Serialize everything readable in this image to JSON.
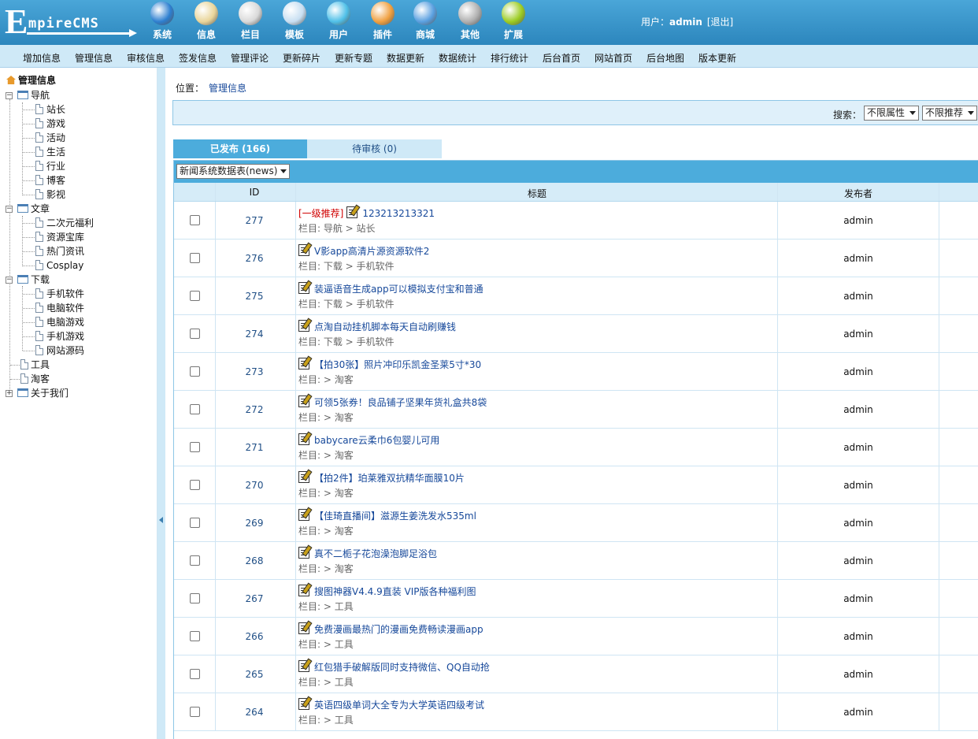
{
  "header": {
    "logo_first": "E",
    "logo_rest": "mpireCMS",
    "nav": [
      {
        "label": "系统",
        "icon": "globe-icon",
        "color": "#2d7fd0"
      },
      {
        "label": "信息",
        "icon": "notepad-icon",
        "color": "#e9d59a"
      },
      {
        "label": "栏目",
        "icon": "folder-icon",
        "color": "#d9d9d9"
      },
      {
        "label": "模板",
        "icon": "window-icon",
        "color": "#c8dff2"
      },
      {
        "label": "用户",
        "icon": "user-icon",
        "color": "#4fc0e8"
      },
      {
        "label": "插件",
        "icon": "tools-icon",
        "color": "#f0a040"
      },
      {
        "label": "商城",
        "icon": "card-icon",
        "color": "#5aa0e0"
      },
      {
        "label": "其他",
        "icon": "gear-icon",
        "color": "#b0b0b0"
      },
      {
        "label": "扩展",
        "icon": "plus-circle-icon",
        "color": "#9ccc22"
      }
    ],
    "user_label": "用户：",
    "username": "admin",
    "logout": "[退出]"
  },
  "subnav": [
    "增加信息",
    "管理信息",
    "审核信息",
    "签发信息",
    "管理评论",
    "更新碎片",
    "更新专题",
    "数据更新",
    "数据统计",
    "排行统计",
    "后台首页",
    "网站首页",
    "后台地图",
    "版本更新"
  ],
  "sidebar": {
    "root": "管理信息",
    "nodes": [
      {
        "label": "导航",
        "type": "folder",
        "expanded": true
      },
      {
        "label": "站长",
        "type": "page"
      },
      {
        "label": "游戏",
        "type": "page"
      },
      {
        "label": "活动",
        "type": "page"
      },
      {
        "label": "生活",
        "type": "page"
      },
      {
        "label": "行业",
        "type": "page"
      },
      {
        "label": "博客",
        "type": "page"
      },
      {
        "label": "影视",
        "type": "page"
      },
      {
        "label": "文章",
        "type": "folder",
        "expanded": true
      },
      {
        "label": "二次元福利",
        "type": "page"
      },
      {
        "label": "资源宝库",
        "type": "page"
      },
      {
        "label": "热门资讯",
        "type": "page"
      },
      {
        "label": "Cosplay",
        "type": "page"
      },
      {
        "label": "下载",
        "type": "folder",
        "expanded": true
      },
      {
        "label": "手机软件",
        "type": "page"
      },
      {
        "label": "电脑软件",
        "type": "page"
      },
      {
        "label": "电脑游戏",
        "type": "page"
      },
      {
        "label": "手机游戏",
        "type": "page"
      },
      {
        "label": "网站源码",
        "type": "page"
      },
      {
        "label": "工具",
        "type": "page"
      },
      {
        "label": "淘客",
        "type": "page"
      },
      {
        "label": "关于我们",
        "type": "folder",
        "expanded": false
      }
    ]
  },
  "main": {
    "location_label": "位置：",
    "location_link": "管理信息",
    "search_label": "搜索：",
    "filter_attr": "不限属性",
    "filter_rec": "不限推荐",
    "tab_published": "已发布 (166)",
    "tab_pending": "待审核 (0)",
    "table_select": "新闻系统数据表(news)",
    "col_id": "ID",
    "col_title": "标题",
    "col_author": "发布者",
    "rows": [
      {
        "id": "277",
        "rec": "[一级推荐]",
        "title": "123213213321",
        "cat": "栏目: 导航 > 站长",
        "author": "admin"
      },
      {
        "id": "276",
        "rec": "",
        "title": "V影app高清片源资源软件2",
        "cat": "栏目: 下载 > 手机软件",
        "author": "admin"
      },
      {
        "id": "275",
        "rec": "",
        "title": "装逼语音生成app可以模拟支付宝和普通",
        "cat": "栏目: 下载 > 手机软件",
        "author": "admin"
      },
      {
        "id": "274",
        "rec": "",
        "title": "点淘自动挂机脚本每天自动刷赚钱",
        "cat": "栏目: 下载 > 手机软件",
        "author": "admin"
      },
      {
        "id": "273",
        "rec": "",
        "title": "【拍30张】照片冲印乐凯金圣莱5寸*30",
        "cat": "栏目: > 淘客",
        "author": "admin"
      },
      {
        "id": "272",
        "rec": "",
        "title": "可领5张券！良品铺子坚果年货礼盒共8袋",
        "cat": "栏目: > 淘客",
        "author": "admin"
      },
      {
        "id": "271",
        "rec": "",
        "title": "babycare云柔巾6包婴儿可用",
        "cat": "栏目: > 淘客",
        "author": "admin"
      },
      {
        "id": "270",
        "rec": "",
        "title": "【拍2件】珀莱雅双抗精华面膜10片",
        "cat": "栏目: > 淘客",
        "author": "admin"
      },
      {
        "id": "269",
        "rec": "",
        "title": "【佳琦直播间】滋源生姜洗发水535ml",
        "cat": "栏目: > 淘客",
        "author": "admin"
      },
      {
        "id": "268",
        "rec": "",
        "title": "真不二栀子花泡澡泡脚足浴包",
        "cat": "栏目: > 淘客",
        "author": "admin"
      },
      {
        "id": "267",
        "rec": "",
        "title": "搜图神器V4.4.9直装 VIP版各种福利图",
        "cat": "栏目: > 工具",
        "author": "admin"
      },
      {
        "id": "266",
        "rec": "",
        "title": "免费漫画最热门的漫画免费畅读漫画app",
        "cat": "栏目: > 工具",
        "author": "admin"
      },
      {
        "id": "265",
        "rec": "",
        "title": "红包猎手破解版同时支持微信、QQ自动抢",
        "cat": "栏目: > 工具",
        "author": "admin"
      },
      {
        "id": "264",
        "rec": "",
        "title": "英语四级单词大全专为大学英语四级考试",
        "cat": "栏目: > 工具",
        "author": "admin"
      }
    ]
  }
}
